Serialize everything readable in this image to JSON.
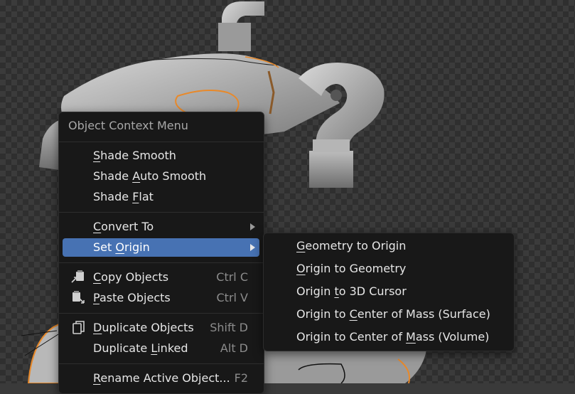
{
  "viewport": {
    "label": "3D viewport",
    "colors": {
      "background": "#3b3b3b",
      "checker": "#2f2f2f",
      "object": "#c8c8c8",
      "selection_outline": "#e8892a"
    }
  },
  "context_menu": {
    "title": "Object Context Menu",
    "items": [
      {
        "pre": "",
        "u": "S",
        "post": "hade Smooth",
        "shortcut": "",
        "icon": ""
      },
      {
        "pre": "Shade ",
        "u": "A",
        "post": "uto Smooth",
        "shortcut": "",
        "icon": ""
      },
      {
        "pre": "Shade ",
        "u": "F",
        "post": "lat",
        "shortcut": "",
        "icon": ""
      },
      {
        "pre": "",
        "u": "C",
        "post": "onvert To",
        "shortcut": "",
        "icon": "",
        "submenu": true
      },
      {
        "pre": "Set ",
        "u": "O",
        "post": "rigin",
        "shortcut": "",
        "icon": "",
        "submenu": true,
        "active": true
      },
      {
        "pre": "",
        "u": "C",
        "post": "opy Objects",
        "shortcut": "Ctrl C",
        "icon": "copy-icon"
      },
      {
        "pre": "",
        "u": "P",
        "post": "aste Objects",
        "shortcut": "Ctrl V",
        "icon": "paste-icon"
      },
      {
        "pre": "",
        "u": "D",
        "post": "uplicate Objects",
        "shortcut": "Shift D",
        "icon": "duplicate-icon"
      },
      {
        "pre": "Duplicate ",
        "u": "L",
        "post": "inked",
        "shortcut": "Alt D",
        "icon": ""
      },
      {
        "pre": "",
        "u": "R",
        "post": "ename Active Object...",
        "shortcut": "F2",
        "icon": ""
      }
    ]
  },
  "submenu": {
    "items": [
      {
        "pre": "",
        "u": "G",
        "post": "eometry to Origin"
      },
      {
        "pre": "",
        "u": "O",
        "post": "rigin to Geometry"
      },
      {
        "pre": "Origin ",
        "u": "t",
        "post": "o 3D Cursor"
      },
      {
        "pre": "Origin to ",
        "u": "C",
        "post": "enter of Mass (Surface)"
      },
      {
        "pre": "Origin to Center of ",
        "u": "M",
        "post": "ass (Volume)"
      }
    ]
  },
  "colors": {
    "menu_bg": "#181818",
    "highlight": "#4772b3",
    "text": "#e6e6e6",
    "shortcut_text": "#8c8c8c"
  }
}
